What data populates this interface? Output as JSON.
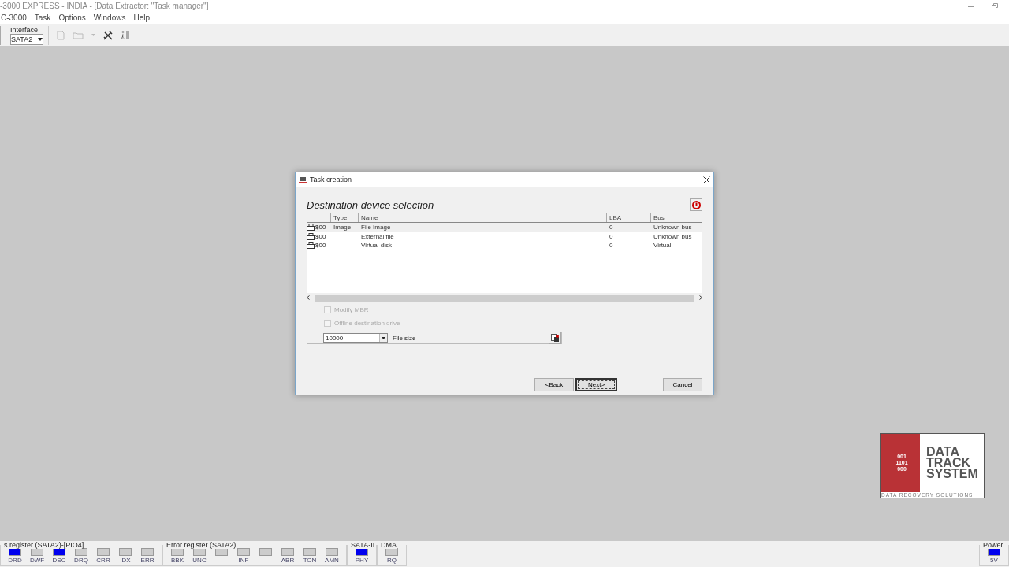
{
  "window": {
    "title": "-3000 EXPRESS - INDIA  - [Data Extractor: \"Task manager\"]"
  },
  "menu": [
    "C-3000",
    "Task",
    "Options",
    "Windows",
    "Help"
  ],
  "toolbar": {
    "interface_label": "Interface",
    "interface_value": "SATA2"
  },
  "dialog": {
    "title": "Task creation",
    "heading": "Destination device selection",
    "columns": [
      "Type",
      "Name",
      "LBA",
      "Bus"
    ],
    "rows": [
      {
        "id": "$00",
        "type": "Image",
        "name": "File Image",
        "lba": "0",
        "bus": "Unknown bus",
        "selected": true
      },
      {
        "id": "$00",
        "name": "External file",
        "lba": "0",
        "bus": "Unknown bus",
        "selected": false
      },
      {
        "id": "$00",
        "name": "Virtual disk",
        "lba": "0",
        "bus": "Virtual",
        "selected": false
      }
    ],
    "options": [
      {
        "label": "Modify MBR",
        "checked": false,
        "disabled": true
      },
      {
        "label": "Offline destination drive",
        "checked": false,
        "disabled": true
      }
    ],
    "file_size": {
      "value": "10000",
      "label": "File size"
    },
    "buttons": [
      {
        "label": "<Back",
        "focused": false
      },
      {
        "label": "Next>",
        "focused": true
      },
      {
        "label": "Cancel",
        "focused": false
      }
    ]
  },
  "logo": {
    "digits": [
      "001",
      "1101",
      "000"
    ],
    "words": [
      "DATA",
      "TRACK",
      "SYSTEM"
    ],
    "tagline": "DATA RECOVERY SOLUTIONS"
  },
  "status_groups": [
    {
      "title": "s register (SATA2)-[PIO4]",
      "leds": [
        {
          "label": "DRD",
          "on": true
        },
        {
          "label": "DWF",
          "on": false
        },
        {
          "label": "DSC",
          "on": true
        },
        {
          "label": "DRQ",
          "on": false
        },
        {
          "label": "CRR",
          "on": false
        },
        {
          "label": "IDX",
          "on": false
        },
        {
          "label": "ERR",
          "on": false
        }
      ]
    },
    {
      "title": "Error register (SATA2)",
      "leds": [
        {
          "label": "BBK",
          "on": false
        },
        {
          "label": "UNC",
          "on": false
        },
        {
          "on": false
        },
        {
          "label": "INF",
          "on": false
        },
        {
          "on": false
        },
        {
          "label": "ABR",
          "on": false
        },
        {
          "label": "TON",
          "on": false
        },
        {
          "label": "AMN",
          "on": false
        }
      ]
    },
    {
      "title": "SATA-II",
      "leds": [
        {
          "label": "PHY",
          "on": true
        }
      ]
    },
    {
      "title": "DMA",
      "leds": [
        {
          "label": "RQ",
          "on": false
        }
      ]
    }
  ],
  "power": {
    "title": "Power",
    "leds": [
      {
        "label": "5V",
        "on": true
      }
    ]
  }
}
